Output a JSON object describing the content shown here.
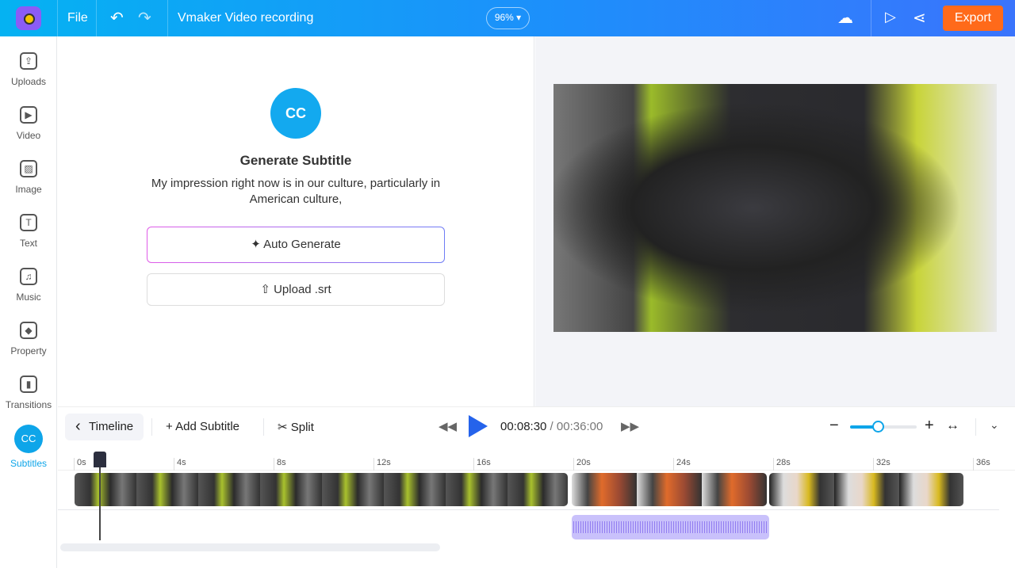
{
  "topbar": {
    "file": "File",
    "title": "Vmaker Video recording",
    "zoom": "96% ▾",
    "export": "Export"
  },
  "sidebar": {
    "items": [
      {
        "label": "Uploads",
        "glyph": "⇪"
      },
      {
        "label": "Video",
        "glyph": "▶"
      },
      {
        "label": "Image",
        "glyph": "▨"
      },
      {
        "label": "Text",
        "glyph": "T"
      },
      {
        "label": "Music",
        "glyph": "♫"
      },
      {
        "label": "Property",
        "glyph": "◆"
      },
      {
        "label": "Transitions",
        "glyph": "▮"
      },
      {
        "label": "Subtitles",
        "glyph": "CC"
      }
    ]
  },
  "panel": {
    "icon": "CC",
    "title": "Generate Subtitle",
    "description": "My impression right now is in our culture, particularly in American culture,",
    "auto_generate": "✦ Auto Generate",
    "upload_srt": "⇧ Upload .srt"
  },
  "timeline": {
    "timeline_label": "Timeline",
    "add_subtitle": "+ Add Subtitle",
    "split": "✂ Split",
    "current_time": "00:08:30",
    "separator": " / ",
    "total_time": "00:36:00",
    "zoom_level": 0.42,
    "ticks": [
      "0s",
      "4s",
      "8s",
      "12s",
      "16s",
      "20s",
      "24s",
      "28s",
      "32s",
      "36s"
    ],
    "clips": [
      {
        "start": 0,
        "end": 19.75
      },
      {
        "start": 19.9,
        "end": 27.7
      },
      {
        "start": 27.8,
        "end": 35.6
      }
    ],
    "audio": {
      "start": 19.9,
      "end": 27.8
    },
    "playhead": 1
  }
}
